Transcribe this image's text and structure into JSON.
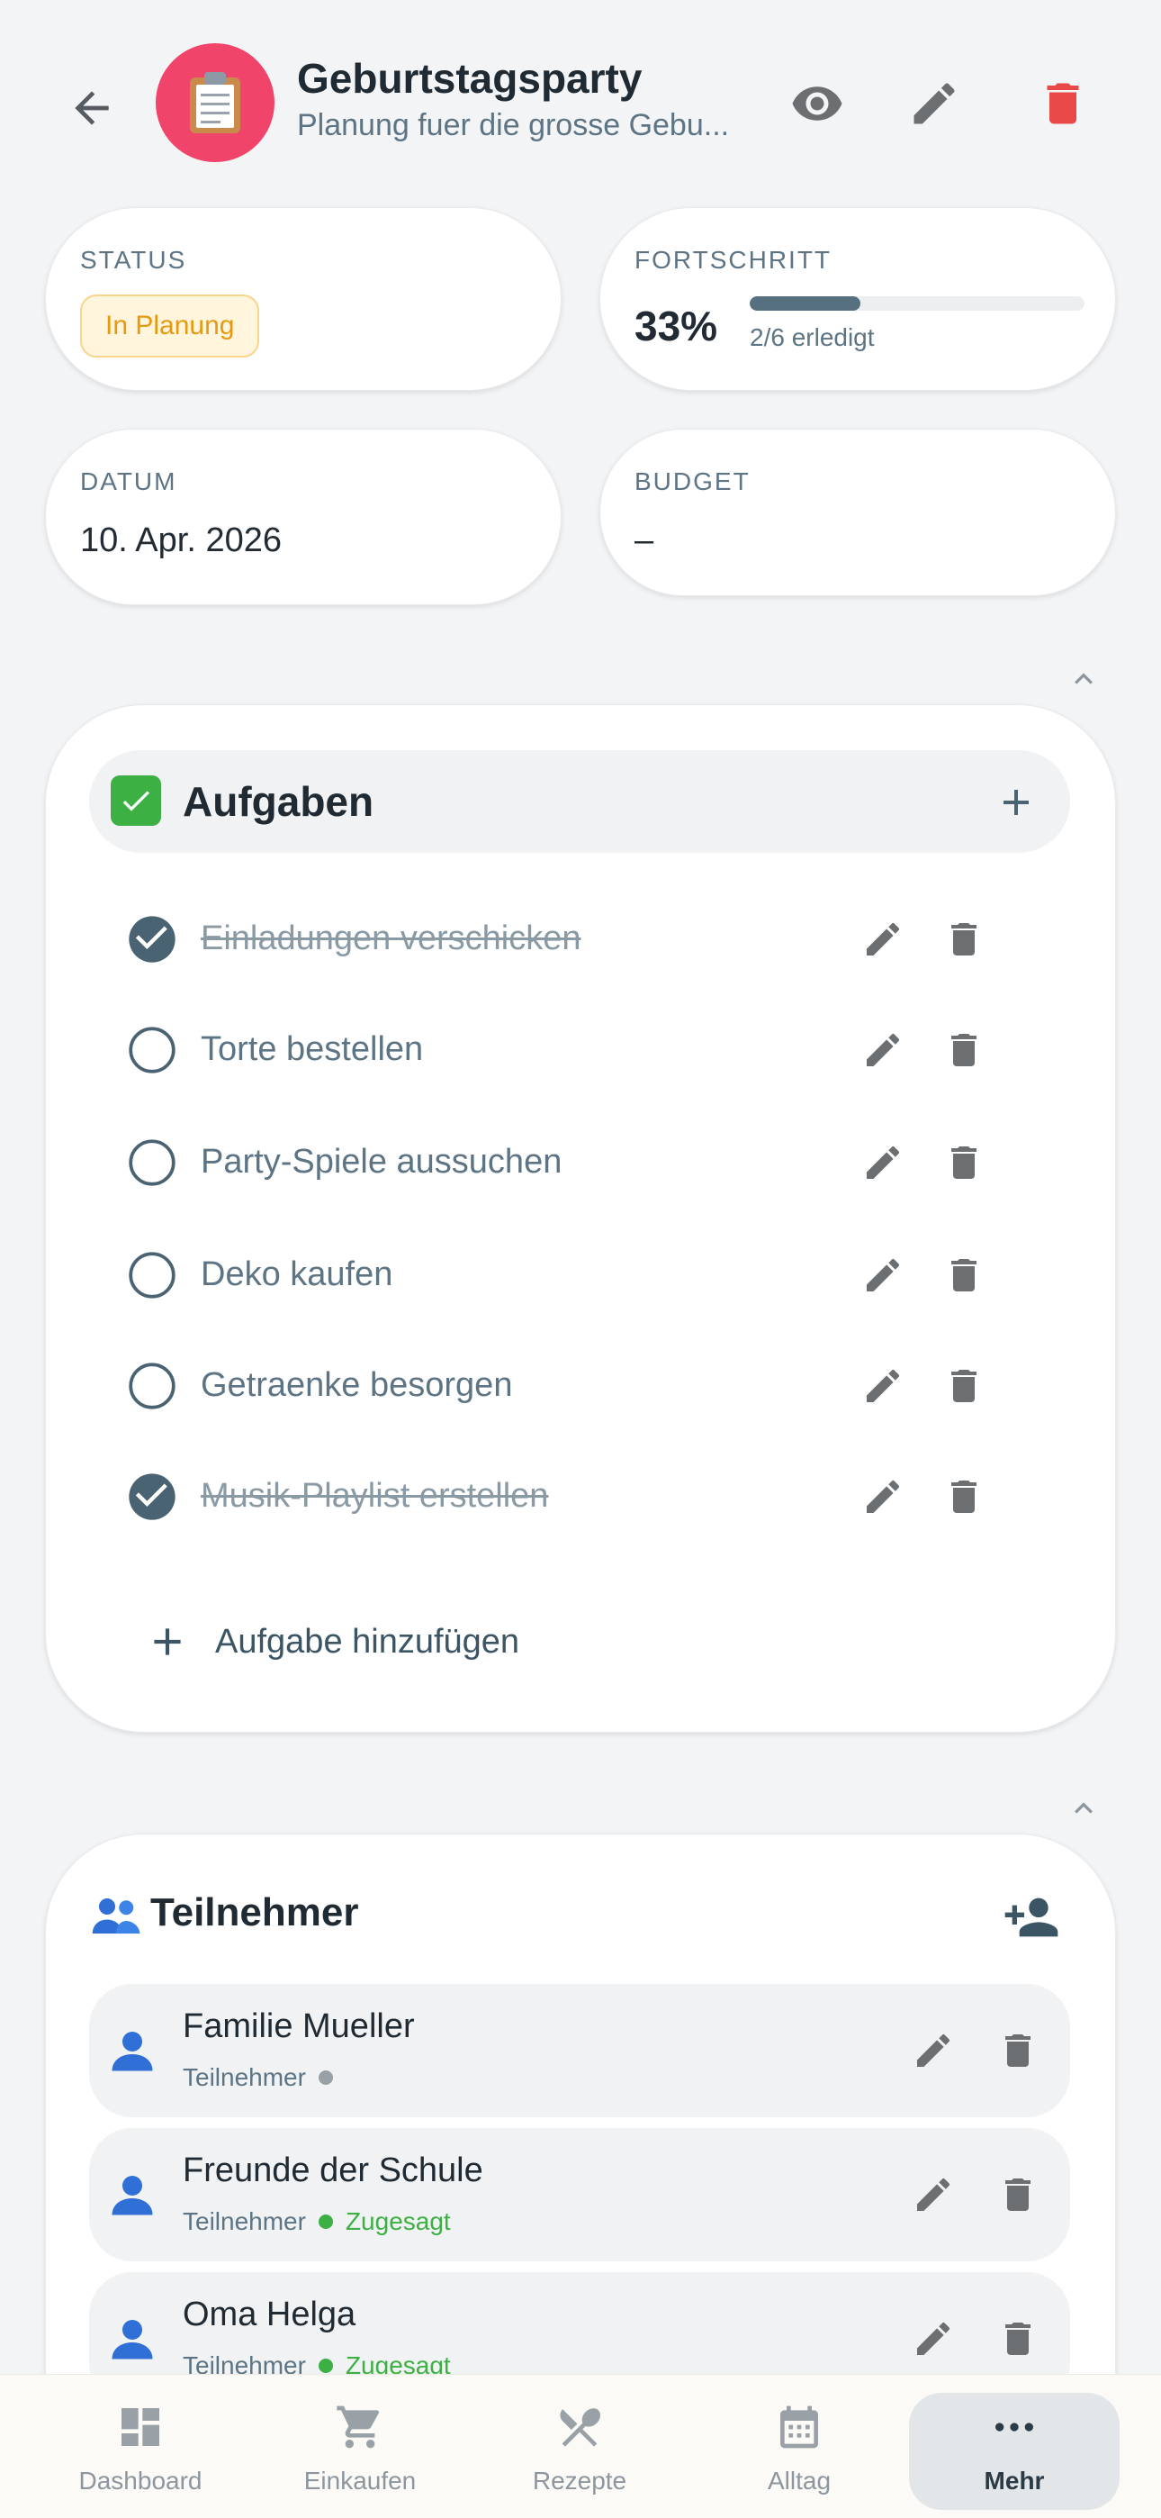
{
  "header": {
    "title": "Geburtstagsparty",
    "subtitle": "Planung fuer die grosse Gebu...",
    "accent_color": "#f0446a",
    "icons": [
      "back-arrow-icon",
      "clipboard-icon",
      "eye-icon",
      "pencil-icon",
      "trash-icon"
    ]
  },
  "info": {
    "status": {
      "label": "STATUS",
      "value": "In Planung"
    },
    "progress": {
      "label": "FORTSCHRITT",
      "percent_text": "33%",
      "fraction": 0.33,
      "caption": "2/6 erledigt"
    },
    "date": {
      "label": "DATUM",
      "value": "10. Apr. 2026"
    },
    "budget": {
      "label": "BUDGET",
      "value": "–"
    }
  },
  "tasks_section": {
    "title": "Aufgaben",
    "add_label": "Aufgabe hinzufügen",
    "items": [
      {
        "label": "Einladungen verschicken",
        "done": true
      },
      {
        "label": "Torte bestellen",
        "done": false
      },
      {
        "label": "Party-Spiele aussuchen",
        "done": false
      },
      {
        "label": "Deko kaufen",
        "done": false
      },
      {
        "label": "Getraenke besorgen",
        "done": false
      },
      {
        "label": "Musik-Playlist erstellen",
        "done": true
      }
    ]
  },
  "participants_section": {
    "title": "Teilnehmer",
    "items": [
      {
        "name": "Familie Mueller",
        "role": "Teilnehmer",
        "rsvp": "",
        "dot_color": "#9aa1a6"
      },
      {
        "name": "Freunde der Schule",
        "role": "Teilnehmer",
        "rsvp": "Zugesagt",
        "dot_color": "#3cb043"
      },
      {
        "name": "Oma Helga",
        "role": "Teilnehmer",
        "rsvp": "Zugesagt",
        "dot_color": "#3cb043"
      }
    ]
  },
  "bottom_nav": {
    "items": [
      {
        "label": "Dashboard",
        "icon": "dashboard-icon"
      },
      {
        "label": "Einkaufen",
        "icon": "cart-icon"
      },
      {
        "label": "Rezepte",
        "icon": "utensils-icon"
      },
      {
        "label": "Alltag",
        "icon": "calendar-icon"
      },
      {
        "label": "Mehr",
        "icon": "more-icon",
        "active": true
      }
    ]
  }
}
